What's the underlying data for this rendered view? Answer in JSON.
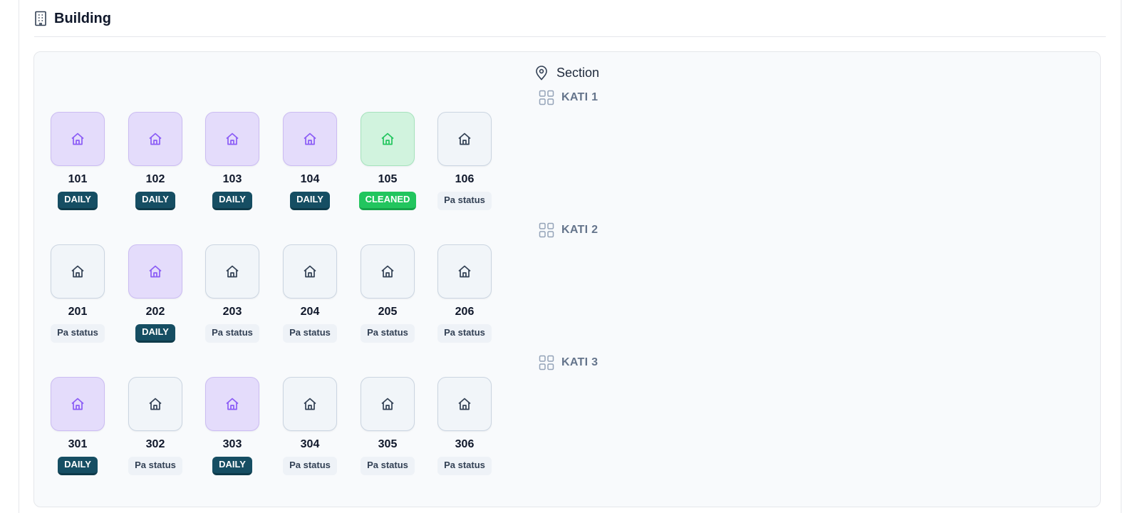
{
  "header": {
    "title": "Building"
  },
  "section": {
    "label": "Section"
  },
  "floors": [
    {
      "label": "KATI 1",
      "rooms": [
        {
          "number": "101",
          "status": "DAILY",
          "tone": "purple"
        },
        {
          "number": "102",
          "status": "DAILY",
          "tone": "purple"
        },
        {
          "number": "103",
          "status": "DAILY",
          "tone": "purple"
        },
        {
          "number": "104",
          "status": "DAILY",
          "tone": "purple"
        },
        {
          "number": "105",
          "status": "CLEANED",
          "tone": "green"
        },
        {
          "number": "106",
          "status": "Pa status",
          "tone": "gray"
        }
      ]
    },
    {
      "label": "KATI 2",
      "rooms": [
        {
          "number": "201",
          "status": "Pa status",
          "tone": "gray"
        },
        {
          "number": "202",
          "status": "DAILY",
          "tone": "purple"
        },
        {
          "number": "203",
          "status": "Pa status",
          "tone": "gray"
        },
        {
          "number": "204",
          "status": "Pa status",
          "tone": "gray"
        },
        {
          "number": "205",
          "status": "Pa status",
          "tone": "gray"
        },
        {
          "number": "206",
          "status": "Pa status",
          "tone": "gray"
        }
      ]
    },
    {
      "label": "KATI 3",
      "rooms": [
        {
          "number": "301",
          "status": "DAILY",
          "tone": "purple"
        },
        {
          "number": "302",
          "status": "Pa status",
          "tone": "gray"
        },
        {
          "number": "303",
          "status": "DAILY",
          "tone": "purple"
        },
        {
          "number": "304",
          "status": "Pa status",
          "tone": "gray"
        },
        {
          "number": "305",
          "status": "Pa status",
          "tone": "gray"
        },
        {
          "number": "306",
          "status": "Pa status",
          "tone": "gray"
        }
      ]
    }
  ],
  "icons": {
    "header": "building-icon",
    "section": "map-pin-icon",
    "floor": "grid-icon",
    "room": "home-icon"
  },
  "colors": {
    "purple_icon": "#8b5cf6",
    "green_icon": "#22c55e",
    "gray_icon": "#334155",
    "daily_badge": "#164e63",
    "cleaned_badge": "#22c55e"
  }
}
